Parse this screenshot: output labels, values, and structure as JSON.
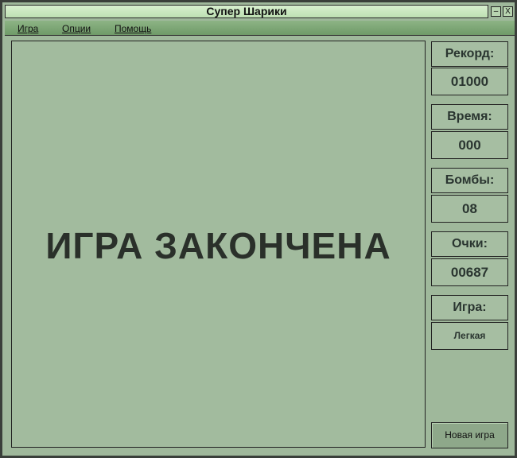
{
  "window": {
    "title": "Супер Шарики",
    "minimize": "–",
    "close": "X"
  },
  "menu": [
    "Игра",
    "Опции",
    "Помощь"
  ],
  "game": {
    "message": "ИГРА ЗАКОНЧЕНА"
  },
  "stats": [
    {
      "label": "Рекорд:",
      "value": "01000"
    },
    {
      "label": "Время:",
      "value": "000"
    },
    {
      "label": "Бомбы:",
      "value": "08"
    },
    {
      "label": "Очки:",
      "value": "00687"
    },
    {
      "label": "Игра:",
      "value": "Легкая"
    }
  ],
  "new_game": "Новая игра"
}
